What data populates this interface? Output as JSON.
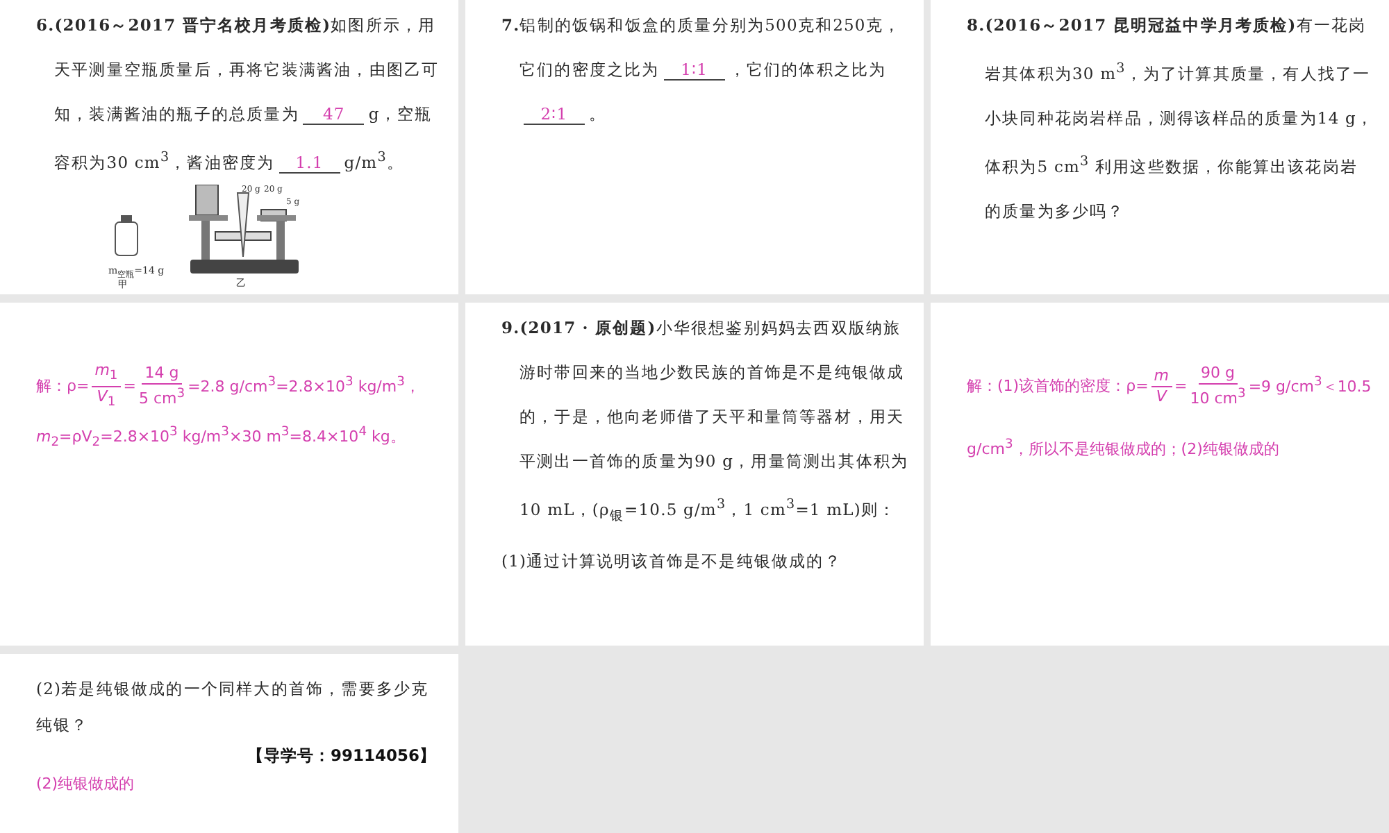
{
  "slides": [
    {
      "blocks": [
        {
          "kind": "question",
          "number": "6.",
          "parts": [
            {
              "kind": "source",
              "text": "(2016～2017 晋宁名校月考质检)"
            },
            {
              "kind": "text",
              "text": "如图所示，用天平测量空瓶质量后，再将它装满酱油，由图乙可知，装满酱油的瓶子的总质量为"
            },
            {
              "kind": "blank",
              "text": "47"
            },
            {
              "kind": "text",
              "text": "g，空瓶容积为30 cm$^{3}$，酱油密度为"
            },
            {
              "kind": "blank",
              "text": "1.1"
            },
            {
              "kind": "text",
              "text": "g/m$^{3}$。"
            }
          ]
        },
        {
          "kind": "figure",
          "bottle_label": "m$_{空瓶}$=14 g",
          "left_caption": "甲",
          "right_caption": "乙",
          "weights": [
            "20 g",
            "20 g",
            "5 g"
          ]
        }
      ]
    },
    {
      "blocks": [
        {
          "kind": "question",
          "number": "7.",
          "parts": [
            {
              "kind": "text",
              "text": "铝制的饭锅和饭盒的质量分别为500克和250克，它们的密度之比为"
            },
            {
              "kind": "blank",
              "text": "1∶1"
            },
            {
              "kind": "text",
              "text": "，它们的体积之比为"
            },
            {
              "kind": "blank",
              "text": "2∶1"
            },
            {
              "kind": "text",
              "text": "。"
            }
          ]
        }
      ]
    },
    {
      "blocks": [
        {
          "kind": "question",
          "number": "8.",
          "parts": [
            {
              "kind": "source",
              "text": "(2016～2017 昆明冠益中学月考质检)"
            },
            {
              "kind": "text",
              "text": "有一花岗岩其体积为30 m$^{3}$，为了计算其质量，有人找了一小块同种花岗岩样品，测得该样品的质量为14 g，体积为5 cm$^{3}$ 利用这些数据，你能算出该花岗岩的质量为多少吗？"
            }
          ]
        }
      ]
    },
    {
      "blocks": [
        {
          "kind": "answer",
          "parts": [
            {
              "kind": "text",
              "text": "解：ρ="
            },
            {
              "kind": "fraction",
              "numerator": "*m*$_{1}$",
              "denominator": "*V*$_{1}$"
            },
            {
              "kind": "text",
              "text": "="
            },
            {
              "kind": "fraction",
              "numerator": "14 g",
              "denominator": "5 cm$^{3}$"
            },
            {
              "kind": "text",
              "text": "=2.8 g/cm$^{3}$=2.8×10$^{3}$ kg/m$^{3}$，"
            }
          ]
        },
        {
          "kind": "answer",
          "parts": [
            {
              "kind": "text",
              "text": "*m*$_{2}$=ρV$_{2}$=2.8×10$^{3}$ kg/m$^{3}$×30 m$^{3}$=8.4×10$^{4}$ kg。"
            }
          ]
        }
      ]
    },
    {
      "blocks": [
        {
          "kind": "question",
          "number": "9.",
          "parts": [
            {
              "kind": "source",
              "text": "(2017 · 原创题)"
            },
            {
              "kind": "text",
              "text": "小华很想鉴别妈妈去西双版纳旅游时带回来的当地少数民族的首饰是不是纯银做成的，于是，他向老师借了天平和量筒等器材，用天平测出一首饰的质量为90 g，用量筒测出其体积为10 mL，(ρ$_{银}$=10.5 g/m$^{3}$，1 cm$^{3}$=1 mL)则："
            }
          ]
        },
        {
          "kind": "subquestion",
          "parts": [
            {
              "kind": "text",
              "text": "(1)通过计算说明该首饰是不是纯银做成的？"
            }
          ]
        }
      ]
    },
    {
      "blocks": [
        {
          "kind": "answer",
          "parts": [
            {
              "kind": "text",
              "text": "解：(1)该首饰的密度：ρ="
            },
            {
              "kind": "fraction",
              "numerator": "*m*",
              "denominator": "*V*"
            },
            {
              "kind": "text",
              "text": "="
            },
            {
              "kind": "fraction",
              "numerator": "90 g",
              "denominator": "10 cm$^{3}$"
            },
            {
              "kind": "text",
              "text": "=9 g/cm$^{3}$＜10.5 g/cm$^{3}$，所以不是纯银做成的；(2)纯银做成的"
            }
          ]
        }
      ]
    },
    {
      "blocks": [
        {
          "kind": "subquestion",
          "reference": "【导学号：99114056】",
          "parts": [
            {
              "kind": "text",
              "text": "(2)若是纯银做成的一个同样大的首饰，需要多少克纯银？"
            }
          ]
        },
        {
          "kind": "answer",
          "parts": [
            {
              "kind": "text",
              "text": "(2)纯银做成的"
            }
          ]
        }
      ]
    }
  ]
}
